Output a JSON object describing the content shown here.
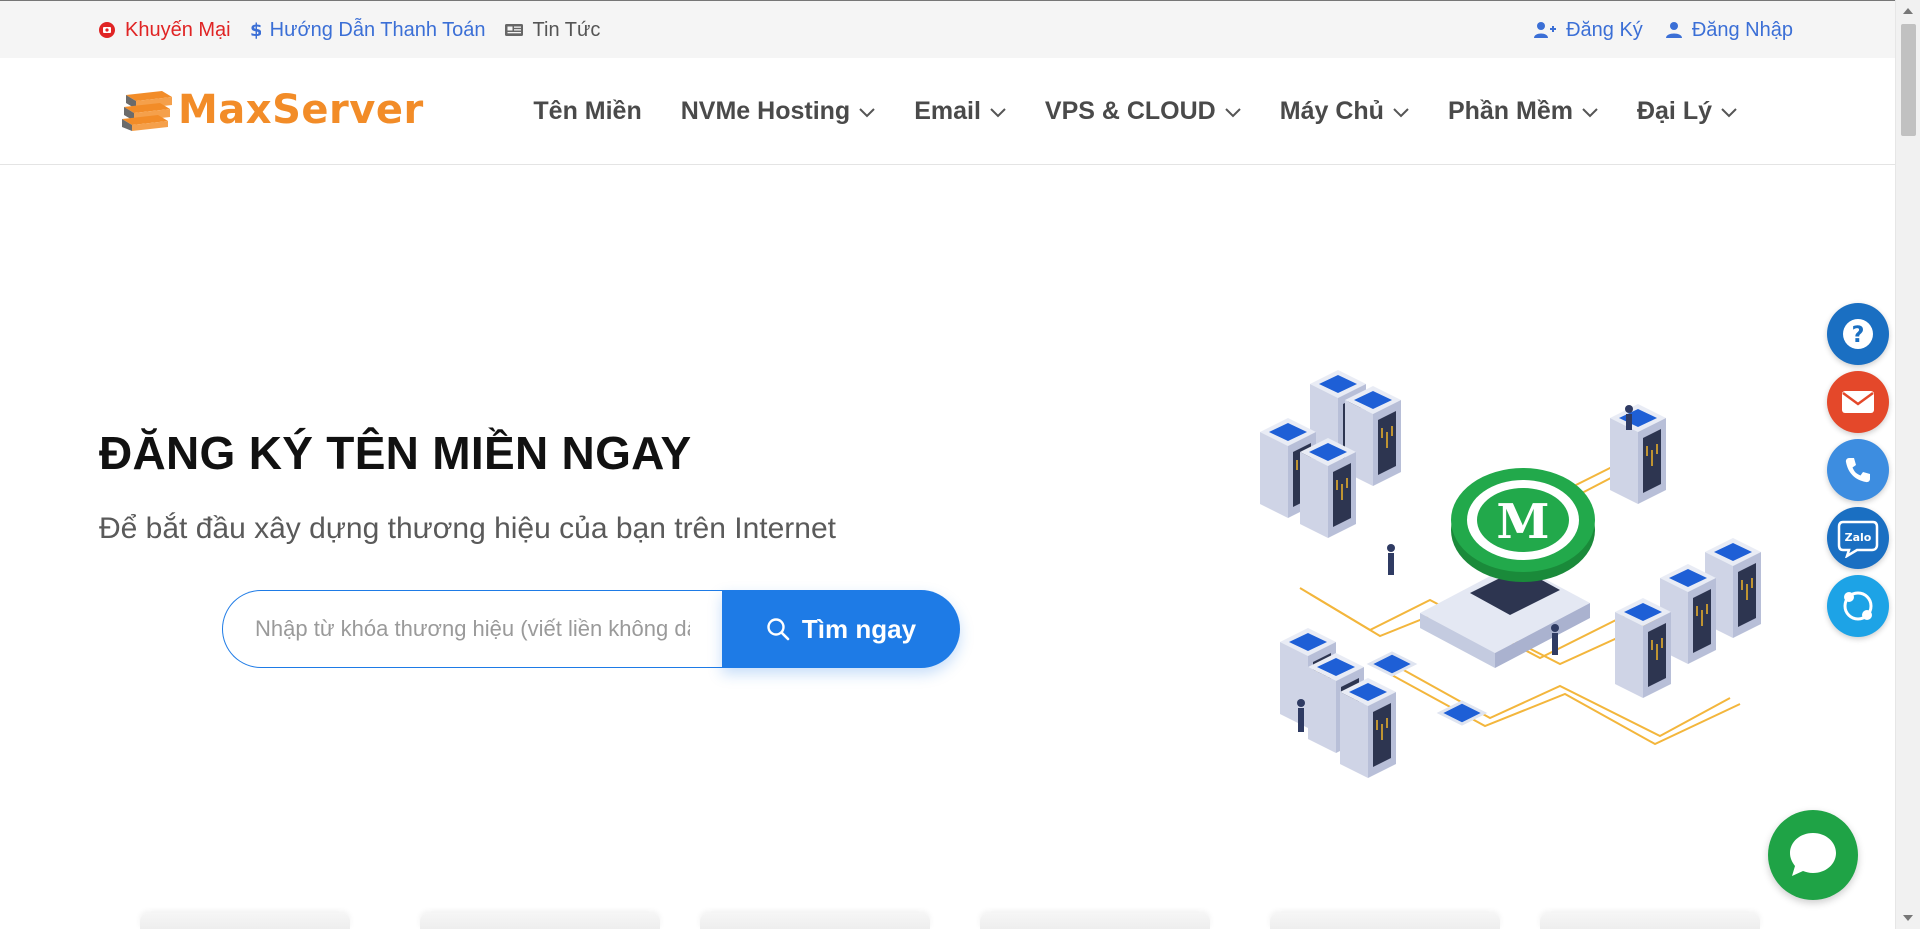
{
  "topbar": {
    "promo_label": "Khuyến Mại",
    "payment_label": "Hướng Dẫn Thanh Toán",
    "news_label": "Tin Tức",
    "register_label": "Đăng Ký",
    "login_label": "Đăng Nhập"
  },
  "header": {
    "logo_text": "MaxServer",
    "nav": [
      {
        "label": "Tên Miền"
      },
      {
        "label": "NVMe Hosting"
      },
      {
        "label": "Email"
      },
      {
        "label": "VPS & CLOUD"
      },
      {
        "label": "Máy Chủ"
      },
      {
        "label": "Phần Mềm"
      },
      {
        "label": "Đại Lý"
      }
    ]
  },
  "hero": {
    "title": "ĐĂNG KÝ TÊN MIỀN NGAY",
    "subtitle": "Để bắt đầu xây dựng thương hiệu của bạn trên Internet",
    "search_placeholder": "Nhập từ khóa thương hiệu (viết liền không dấu)",
    "search_value": "",
    "search_button_label": "Tìm ngay"
  },
  "floating_buttons": [
    {
      "icon": "question-icon",
      "color": "#1a6fc2"
    },
    {
      "icon": "mail-icon",
      "color": "#e4482a"
    },
    {
      "icon": "phone-icon",
      "color": "#3d8de0"
    },
    {
      "icon": "zalo-icon",
      "color": "#1a6fc2",
      "text": "Zalo"
    },
    {
      "icon": "skype-icon",
      "color": "#1da3e6"
    }
  ],
  "chat": {
    "icon": "chat-bubble-icon",
    "color": "#1fa346"
  },
  "colors": {
    "accent": "#1e7be6",
    "logo_orange": "#f28c28",
    "promo_red": "#e02424",
    "link_blue": "#3b6fd6"
  }
}
